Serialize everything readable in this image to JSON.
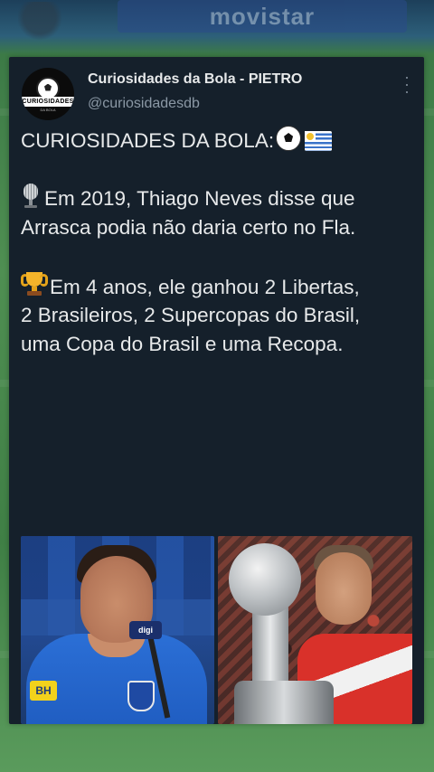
{
  "background": {
    "banner_text": "movistar"
  },
  "tweet": {
    "author": {
      "name": "Curiosidades da Bola - PIETRO",
      "handle": "@curiosidadesdb",
      "avatar_badge": "CURIOSIDADES",
      "avatar_sub": "DA BOLA"
    },
    "text": {
      "line_title": "CURIOSIDADES DA BOLA:",
      "paragraph1": "Em 2019, Thiago Neves disse que Arrasca podia não daria certo no Fla.",
      "paragraph2": "Em 4 anos, ele ganhou 2 Libertas,\n2 Brasileiros, 2 Supercopas do Brasil,\numa Copa do Brasil e uma Recopa."
    },
    "icons": {
      "title_emoji_1": "soccer-ball-icon",
      "title_emoji_2": "uruguay-flag-icon",
      "paragraph1_emoji": "studio-microphone-icon",
      "paragraph2_emoji": "trophy-icon",
      "menu": "more-vertical-icon"
    },
    "photos": {
      "left": {
        "jersey_badge": "BH",
        "mic_label": "digi"
      },
      "right": {}
    }
  },
  "colors": {
    "card_bg": "#15202b",
    "text_primary": "#e7e9ea",
    "text_secondary": "#8b98a5"
  }
}
